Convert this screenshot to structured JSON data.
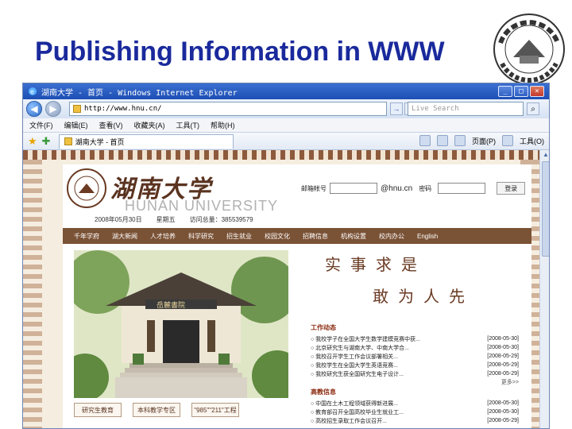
{
  "slide": {
    "title": "Publishing Information in WWW",
    "seal_text": "湖南大學",
    "seal_en": "HUNAN UNIVERSITY"
  },
  "browser": {
    "window_title": "湖南大学 - 首页 - Windows Internet Explorer",
    "address": "http://www.hnu.cn/",
    "search_placeholder": "Live Search",
    "menu": [
      "文件(F)",
      "编辑(E)",
      "查看(V)",
      "收藏夹(A)",
      "工具(T)",
      "帮助(H)"
    ],
    "tab_label": "湖南大学 - 首页",
    "commands": {
      "page": "页面(P)",
      "tools": "工具(O)"
    }
  },
  "site": {
    "logo_cn": "湖南大学",
    "logo_en": "HUNAN UNIVERSITY",
    "login": {
      "user_label": "邮箱帐号",
      "domain": "@hnu.cn",
      "pass_label": "密码",
      "button": "登录"
    },
    "date": "2008年05月30日",
    "weather_label": "星期五",
    "visits": "访问总量：385539579",
    "nav": [
      "千年学府",
      "湖大新闻",
      "人才培养",
      "科学研究",
      "招生就业",
      "校园文化",
      "招聘信息",
      "机构设置",
      "校内办公",
      "English"
    ],
    "motto_line1": "实事求是",
    "motto_line2": "敢为人先",
    "news_sections": [
      {
        "heading": "工作动态",
        "items": [
          {
            "title": "○ 我校学子在全国大学生数学建模竞赛中获...",
            "date": "[2008-05-30]"
          },
          {
            "title": "○ 北京研究生与湖南大学、中南大学合...",
            "date": "[2008-05-30]"
          },
          {
            "title": "○ 我校召开学生工作会议部署相关...",
            "date": "[2008-05-29]"
          },
          {
            "title": "○ 我校学生在全国大学生英语竞赛...",
            "date": "[2008-05-29]"
          },
          {
            "title": "○ 我校研究生获全国研究生电子设计...",
            "date": "[2008-05-29]"
          }
        ]
      },
      {
        "heading": "高教信息",
        "items": [
          {
            "title": "○ 中国在土木工程领域获得新进展...",
            "date": "[2008-05-30]"
          },
          {
            "title": "○ 教育部召开全国高校毕业生就业工...",
            "date": "[2008-05-30]"
          },
          {
            "title": "○ 高校招生录取工作会议召开...",
            "date": "[2008-05-29]"
          }
        ]
      }
    ],
    "more_label": "更多>>",
    "bottom_links": [
      "研究生教育",
      "本科教学专区",
      "\"985\"\"211\"工程"
    ],
    "photo_plaque": "岳麓書院"
  }
}
